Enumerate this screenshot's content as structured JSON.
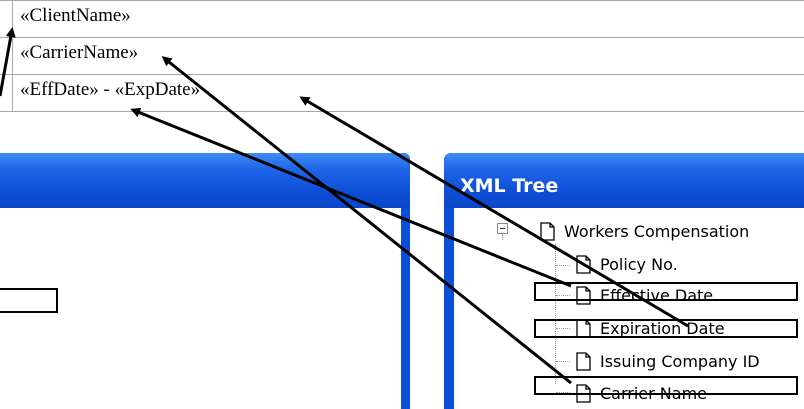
{
  "document": {
    "fields": {
      "row1": "«ClientName»",
      "row2": "«CarrierName»",
      "row3": "«EffDate» - «ExpDate»"
    }
  },
  "xml_tree": {
    "title": "XML Tree",
    "root": "Workers Compensation",
    "items": [
      "Policy No.",
      "Effective Date",
      "Expiration Date",
      "Issuing Company ID",
      "Carrier Name"
    ]
  },
  "colors": {
    "xp_title_blue": "#0a4fd8",
    "arrow": "#000000"
  }
}
